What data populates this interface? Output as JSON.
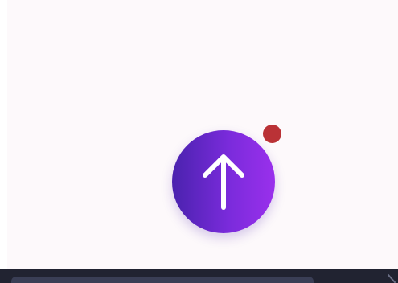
{
  "fab": {
    "icon": "arrow-up-icon",
    "gradient": [
      "#4a22ae",
      "#7a2bdb",
      "#9a30ec"
    ]
  },
  "notification_dot": {
    "color": "#ba3236"
  },
  "colors": {
    "page_background": "#fdf9fb",
    "bottom_bar": "#212331",
    "bottom_bar_track": "#3a3e55"
  }
}
